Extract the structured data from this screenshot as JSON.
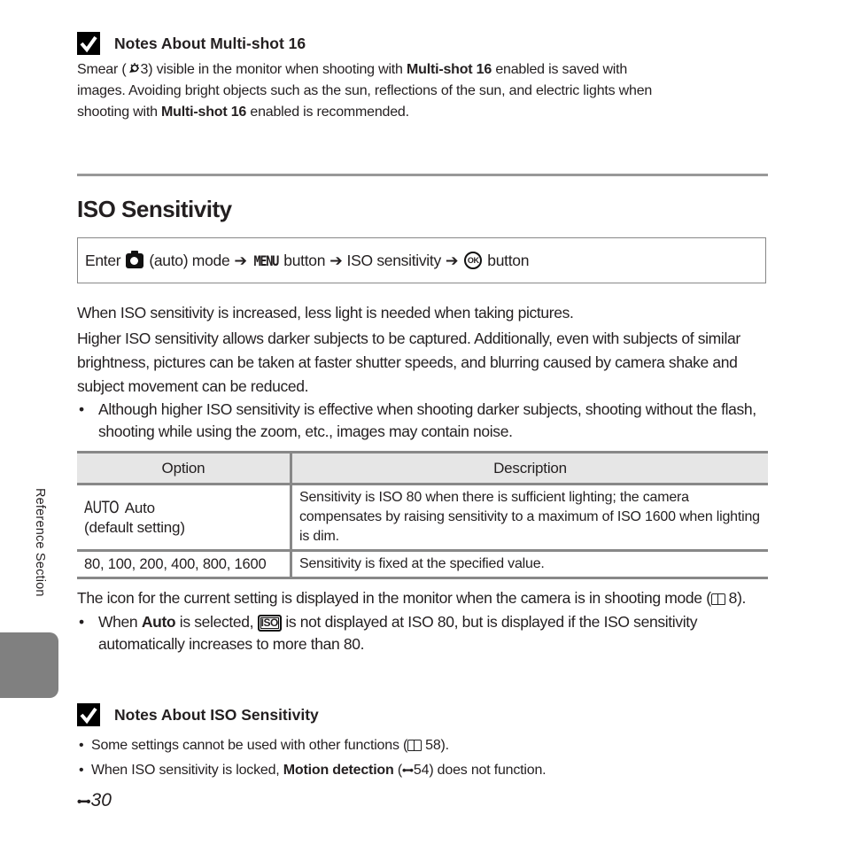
{
  "note1": {
    "icon": "check-mark-icon",
    "title": "Notes About Multi-shot 16",
    "line1_a": "Smear (",
    "line1_ref": "3",
    "line1_b": ") visible in the monitor when shooting with ",
    "line1_bold": "Multi-shot 16",
    "line1_c": " enabled is saved with",
    "line2": "images. Avoiding bright objects such as the sun, reflections of the sun, and electric lights when",
    "line3_a": "shooting with ",
    "line3_bold": "Multi-shot 16",
    "line3_b": " enabled is recommended."
  },
  "section": {
    "title": "ISO Sensitivity",
    "nav": {
      "enter": "Enter",
      "mode": "(auto) mode",
      "arrow": "➔",
      "menu": "MENU",
      "button1": "button",
      "item": "ISO sensitivity",
      "ok": "OK",
      "button2": "button"
    },
    "para1": "When ISO sensitivity is increased, less light is needed when taking pictures.",
    "para2": "Higher ISO sensitivity allows darker subjects to be captured. Additionally, even with subjects of similar brightness, pictures can be taken at faster shutter speeds, and blurring caused by camera shake and subject movement can be reduced.",
    "bullet1": "Although higher ISO sensitivity is effective when shooting darker subjects, shooting without the flash, shooting while using the zoom, etc., images may contain noise."
  },
  "table": {
    "headers": [
      "Option",
      "Description"
    ],
    "rows": [
      {
        "option_icon": "AUTO",
        "option_label": "Auto",
        "option_sub": "(default setting)",
        "description": "Sensitivity is ISO 80 when there is sufficient lighting; the camera compensates by raising sensitivity to a maximum of ISO 1600 when lighting is dim."
      },
      {
        "option_label": "80, 100, 200, 400, 800, 1600",
        "description": "Sensitivity is fixed at the specified value."
      }
    ]
  },
  "after_table": {
    "para_a": "The icon for the current setting is displayed in the monitor when the camera is in shooting mode (",
    "para_ref": "8",
    "para_b": ").",
    "bullet_a": "When ",
    "bullet_bold": "Auto",
    "bullet_b": " is selected, ",
    "iso_icon": "ISO",
    "bullet_c": " is not displayed at ISO 80, but is displayed if the ISO sensitivity automatically increases to more than 80."
  },
  "note2": {
    "icon": "check-mark-icon",
    "title": "Notes About ISO Sensitivity",
    "bullet1_a": "Some settings cannot be used with other functions (",
    "bullet1_ref": "58",
    "bullet1_b": ").",
    "bullet2_a": "When ISO sensitivity is locked, ",
    "bullet2_bold": "Motion detection",
    "bullet2_b": " (",
    "bullet2_ref": "54",
    "bullet2_c": ") does not function."
  },
  "sidebar": {
    "label": "Reference Section",
    "tab_color": "#808080"
  },
  "footer": {
    "page_prefix_icon": "reference-section-icon",
    "page_number": "30"
  }
}
